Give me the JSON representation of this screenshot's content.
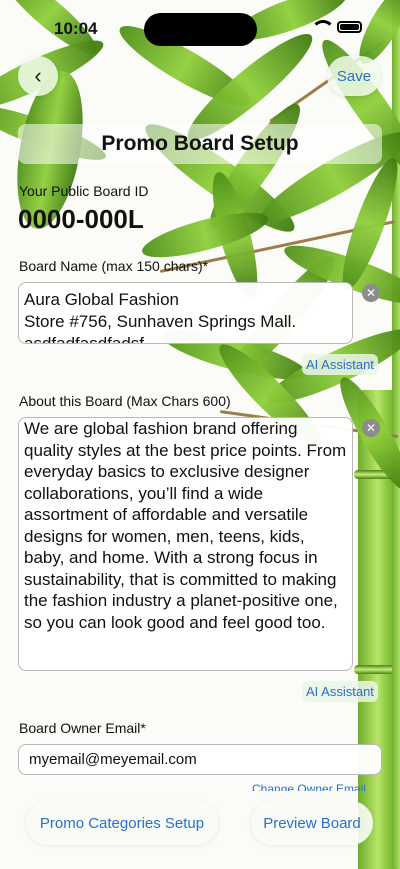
{
  "status_bar": {
    "time": "10:04"
  },
  "nav": {
    "back_icon": "chevron-left-icon",
    "save_label": "Save"
  },
  "header": {
    "title": "Promo Board Setup"
  },
  "board_id": {
    "label": "Your Public Board ID",
    "value": "0000-000L"
  },
  "board_name": {
    "label": "Board Name (max 150 chars)*",
    "value": "Aura Global Fashion\nStore #756, Sunhaven Springs Mall.\nasdfadfasdfadsf"
  },
  "about": {
    "label": "About this Board (Max Chars 600)",
    "value": "We are global fashion brand offering quality styles at the best price points. From everyday basics to exclusive designer collaborations, you’ll find a wide assortment of affordable and versatile designs for women, men, teens, kids, baby, and home. With a strong focus in sustainability, that is committed to making the fashion industry a planet-positive one, so you can look good and feel good too."
  },
  "ai_assistant_label": "AI Assistant",
  "owner_email": {
    "label": "Board Owner Email*",
    "value": "myemail@meyemail.com",
    "change_label": "Change Owner Email"
  },
  "bottom": {
    "categories_label": "Promo Categories Setup",
    "preview_label": "Preview Board"
  },
  "colors": {
    "accent": "#2a6fc9",
    "bamboo_green": "#7cbf2f"
  }
}
